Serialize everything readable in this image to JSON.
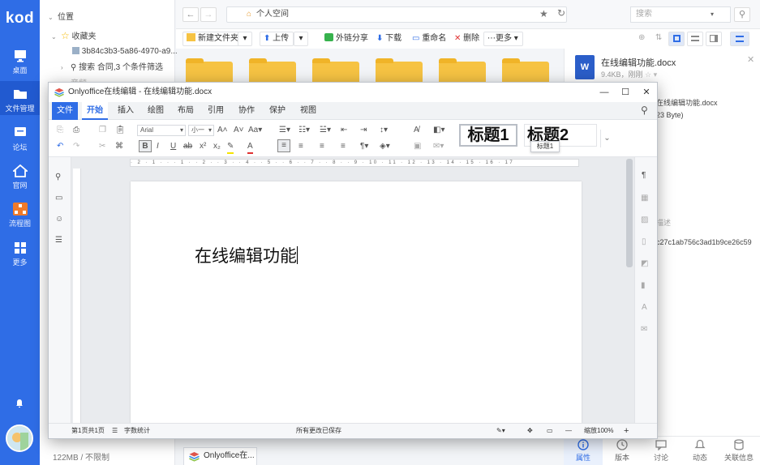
{
  "rail": {
    "logo": "kod",
    "items": [
      {
        "label": "桌面",
        "icon": "monitor-icon"
      },
      {
        "label": "文件管理",
        "icon": "folder-icon"
      },
      {
        "label": "论坛",
        "icon": "forum-icon"
      },
      {
        "label": "官网",
        "icon": "home-icon"
      },
      {
        "label": "流程图",
        "icon": "flowchart-icon"
      },
      {
        "label": "更多",
        "icon": "grid-icon"
      }
    ]
  },
  "tree": {
    "location": "位置",
    "favorites": "收藏夹",
    "fav_item": "3b84c3b3-5a86-4970-a9...",
    "search_item": "搜索 合同,3 个条件筛选",
    "partial_item": "音频",
    "quota": "122MB / 不限制"
  },
  "path": {
    "current": "个人空间",
    "search_placeholder": "搜索"
  },
  "toolbar": {
    "new_folder": "新建文件夹",
    "upload": "上传",
    "share": "外链分享",
    "download": "下载",
    "rename": "重命名",
    "delete": "删除",
    "more": "更多"
  },
  "info": {
    "filename": "在线编辑功能.docx",
    "meta": "9.4KB，刚刚",
    "path_text": "在线编辑功能.docx",
    "size_text": "23 Byte)",
    "desc": "描述",
    "hash": "c27c1ab756c3ad1b9ce26c59",
    "tabs": [
      "属性",
      "版本",
      "讨论",
      "动态",
      "关联信息"
    ]
  },
  "taskbar": {
    "label": "Onlyoffice在..."
  },
  "editor": {
    "title": "Onlyoffice在线编辑 - 在线编辑功能.docx",
    "menu": [
      "文件",
      "开始",
      "插入",
      "绘图",
      "布局",
      "引用",
      "协作",
      "保护",
      "视图"
    ],
    "font": "Arial",
    "size": "小一",
    "heading1": "标题1",
    "heading2": "标题2",
    "tooltip": "标题1",
    "ruler": "· 2 · 1 · · · 1 · · 2 · · 3 · · 4 · · 5 · · 6 · · 7 · · 8 · · 9 · 10 · 11 · 12 · 13 · 14 · 15 · 16 · 17",
    "doc_text": "在线编辑功能",
    "status": {
      "page": "第1页共1页",
      "wordcount": "字数统计",
      "saved": "所有更改已保存",
      "zoom": "缩放100%"
    }
  },
  "colors": {
    "accent": "#2f6de6",
    "folder": "#f6c343"
  }
}
